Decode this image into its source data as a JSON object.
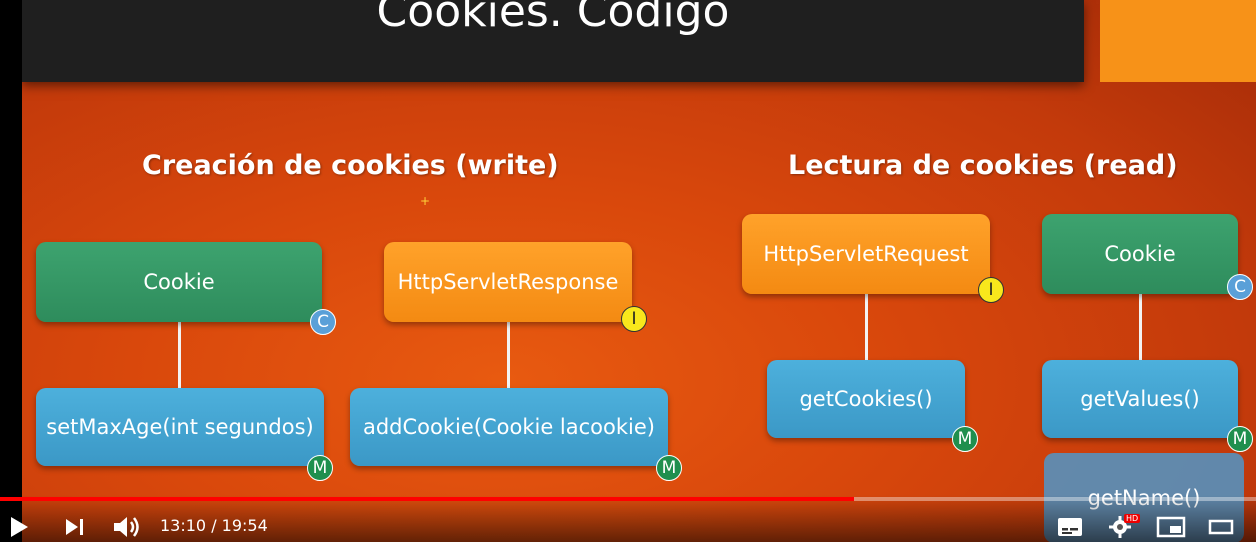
{
  "slide": {
    "title": "Cookies. Codigo",
    "left_section": "Creación de cookies (write)",
    "right_section": "Lectura de cookies (read)",
    "sparkle": "+",
    "boxes": {
      "cookie_left": "Cookie",
      "http_response": "HttpServletResponse",
      "set_max_age": "setMaxAge(int segundos)",
      "add_cookie": "addCookie(Cookie lacookie)",
      "http_request": "HttpServletRequest",
      "cookie_right": "Cookie",
      "get_cookies": "getCookies()",
      "get_values": "getValues()",
      "get_name": "getName()"
    },
    "badges": {
      "class": "C",
      "interface": "I",
      "method": "M"
    }
  },
  "player": {
    "current_time": "13:10",
    "separator": " / ",
    "duration": "19:54",
    "progress": 0.68,
    "hd_label": "HD",
    "icons": [
      "play-icon",
      "next-icon",
      "volume-icon",
      "subtitles-icon",
      "settings-icon",
      "miniplayer-icon",
      "theater-icon"
    ]
  },
  "colors": {
    "green": "#3da36f",
    "orange": "#f79218",
    "blue": "#4db0dc",
    "progress": "#ff0000",
    "title_bar": "#1f1f1f"
  }
}
